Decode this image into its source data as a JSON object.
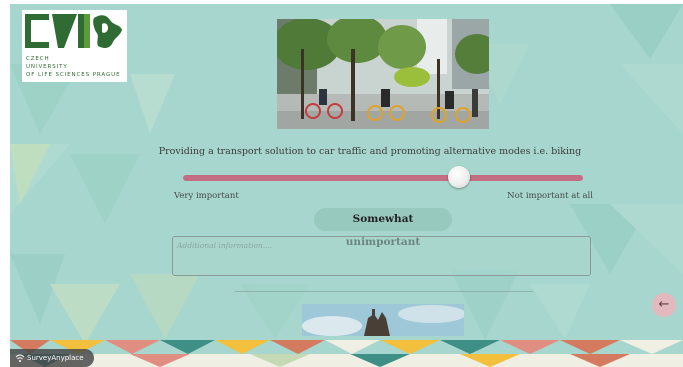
{
  "logo": {
    "line1": "CZECH",
    "line2": "UNIVERSITY",
    "line3": "OF LIFE SCIENCES PRAGUE"
  },
  "question": {
    "text": "Providing a transport solution to car traffic and promoting alternative modes i.e. biking"
  },
  "slider": {
    "min_label": "Very important",
    "max_label": "Not important at all",
    "value_fraction": 0.69,
    "selected_label": "Somewhat unimportant"
  },
  "additional_info": {
    "placeholder": "Additional information....",
    "value": ""
  },
  "nav": {
    "back_glyph": "←"
  },
  "branding": {
    "text": "SurveyAnyplace"
  },
  "colors": {
    "background": "#a6d6cd",
    "slider_track": "#c36d82",
    "back_button": "#e4b9be"
  }
}
